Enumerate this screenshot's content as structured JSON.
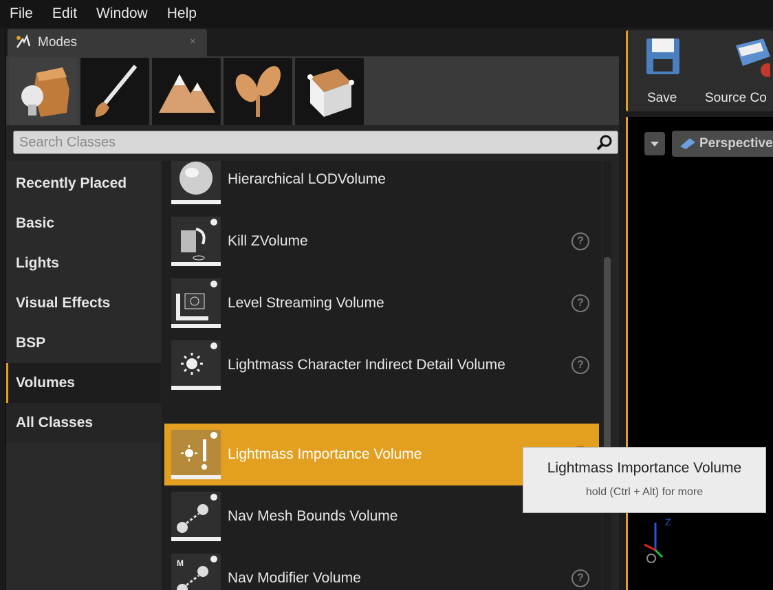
{
  "menu": [
    "File",
    "Edit",
    "Window",
    "Help"
  ],
  "modes_tab": {
    "label": "Modes",
    "close_glyph": "×"
  },
  "mode_buttons": [
    "place-mode-icon",
    "paint-mode-icon",
    "landscape-mode-icon",
    "foliage-mode-icon",
    "geometry-mode-icon"
  ],
  "search": {
    "placeholder": "Search Classes",
    "value": ""
  },
  "categories": [
    {
      "label": "Recently Placed",
      "active": false
    },
    {
      "label": "Basic",
      "active": false
    },
    {
      "label": "Lights",
      "active": false
    },
    {
      "label": "Visual Effects",
      "active": false
    },
    {
      "label": "BSP",
      "active": false
    },
    {
      "label": "Volumes",
      "active": true
    },
    {
      "label": "All Classes",
      "active": false
    }
  ],
  "classes": [
    {
      "label": "Hierarchical LODVolume",
      "icon": "sphere-volume-icon",
      "help": false,
      "selected": false
    },
    {
      "label": "Kill ZVolume",
      "icon": "kill-z-volume-icon",
      "help": true,
      "selected": false
    },
    {
      "label": "Level Streaming Volume",
      "icon": "level-streaming-volume-icon",
      "help": true,
      "selected": false
    },
    {
      "label": "Lightmass Character Indirect Detail Volume",
      "icon": "lightmass-character-volume-icon",
      "help": true,
      "selected": false
    },
    {
      "label": "Lightmass Importance Volume",
      "icon": "lightmass-importance-volume-icon",
      "help": true,
      "selected": true
    },
    {
      "label": "Nav Mesh Bounds Volume",
      "icon": "nav-mesh-bounds-volume-icon",
      "help": false,
      "selected": false
    },
    {
      "label": "Nav Modifier Volume",
      "icon": "nav-modifier-volume-icon",
      "help": true,
      "selected": false
    }
  ],
  "help_glyph": "?",
  "tooltip": {
    "title": "Lightmass Importance Volume",
    "hint": "hold (Ctrl + Alt) for more"
  },
  "toolbar": {
    "save_label": "Save",
    "source_label": "Source Co"
  },
  "viewport": {
    "perspective_label": "Perspective"
  },
  "colors": {
    "accent": "#e3a020",
    "panel": "#252525",
    "background": "#1a1a1a"
  }
}
